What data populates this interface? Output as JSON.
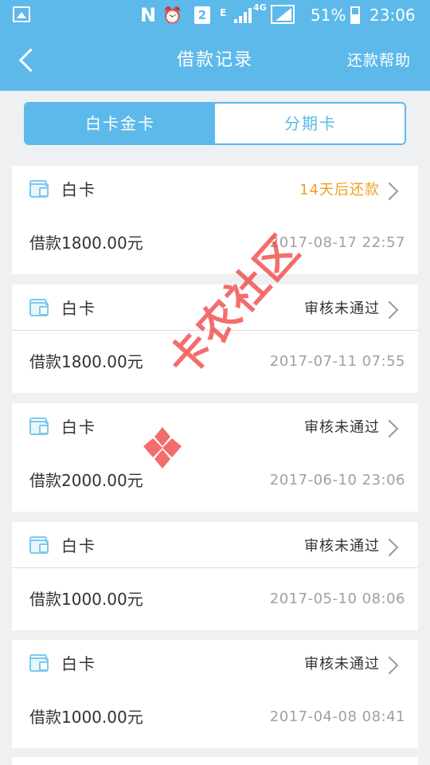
{
  "status_bar": {
    "n_glyph": "N",
    "sim": "2",
    "network_e": "E",
    "network_4g": "4G",
    "battery": "51%",
    "time": "23:06"
  },
  "header": {
    "title": "借款记录",
    "help_link": "还款帮助"
  },
  "tabs": [
    {
      "label": "白卡金卡",
      "active": true
    },
    {
      "label": "分期卡",
      "active": false
    }
  ],
  "records": [
    {
      "card_type": "白卡",
      "status": "14天后还款",
      "amount": "借款1800.00元",
      "time": "2017-08-17 22:57"
    },
    {
      "card_type": "白卡",
      "status": "审核未通过",
      "amount": "借款1800.00元",
      "time": "2017-07-11 07:55"
    },
    {
      "card_type": "白卡",
      "status": "审核未通过",
      "amount": "借款2000.00元",
      "time": "2017-06-10 23:06"
    },
    {
      "card_type": "白卡",
      "status": "审核未通过",
      "amount": "借款1000.00元",
      "time": "2017-05-10 08:06"
    },
    {
      "card_type": "白卡",
      "status": "审核未通过",
      "amount": "借款1000.00元",
      "time": "2017-04-08 08:41"
    }
  ],
  "watermark": {
    "text": "卡农社区"
  },
  "colors": {
    "primary": "#5cb9ea",
    "due_status": "#f0a020",
    "watermark": "#f03c3c"
  }
}
